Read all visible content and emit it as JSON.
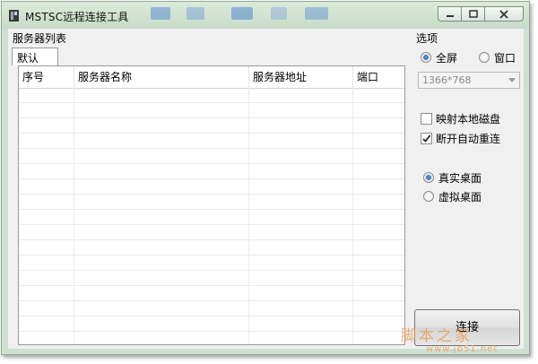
{
  "window": {
    "title": "MSTSC远程连接工具"
  },
  "left": {
    "group_label": "服务器列表",
    "tabs": [
      "默认"
    ],
    "columns": [
      "序号",
      "服务器名称",
      "服务器地址",
      "端口"
    ]
  },
  "options": {
    "group_label": "选项",
    "fullscreen_label": "全屏",
    "window_label": "窗口",
    "fullscreen_selected": true,
    "resolution": "1366*768",
    "map_disk_label": "映射本地磁盘",
    "map_disk_checked": false,
    "auto_reconnect_label": "断开自动重连",
    "auto_reconnect_checked": true,
    "real_desktop_label": "真实桌面",
    "virtual_desktop_label": "虚拟桌面",
    "real_desktop_selected": true
  },
  "connect_label": "连接",
  "watermark": {
    "text": "脚本之家",
    "url": "www.jb51.net"
  },
  "colors": {
    "accent": "#1f5ea8",
    "watermark": "#e7a05a"
  }
}
